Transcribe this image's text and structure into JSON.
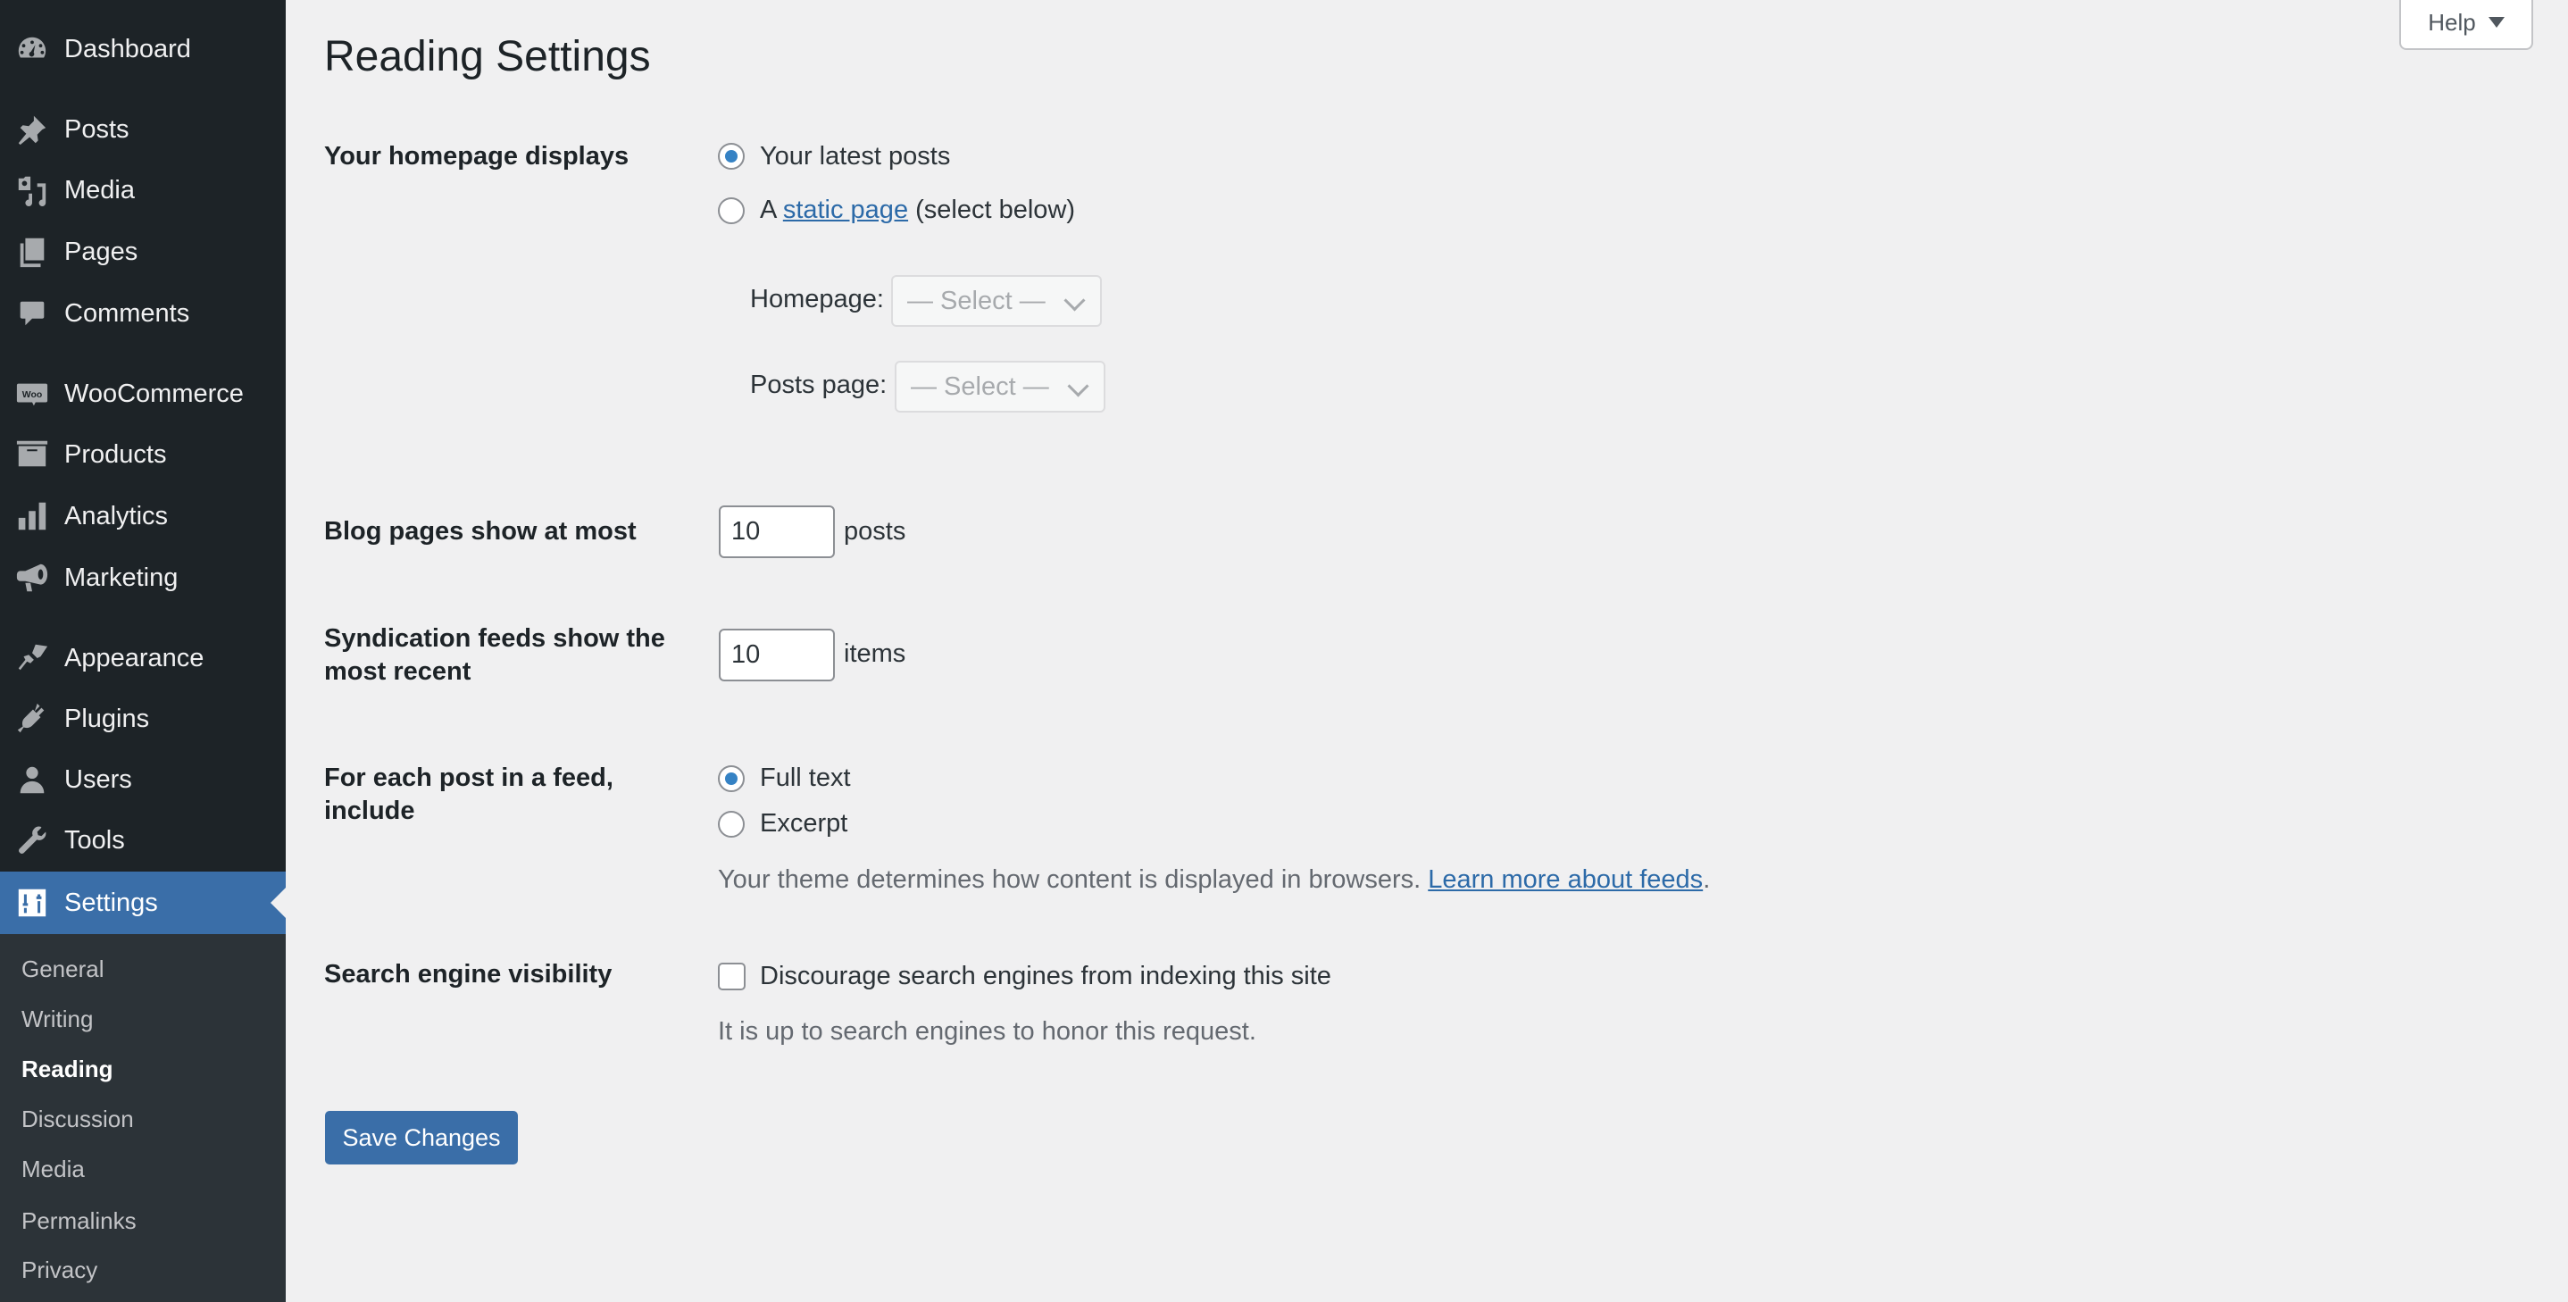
{
  "sidebar": {
    "items": [
      {
        "label": "Dashboard",
        "icon": "dashboard-icon"
      },
      {
        "label": "Posts",
        "icon": "pin-icon"
      },
      {
        "label": "Media",
        "icon": "media-icon"
      },
      {
        "label": "Pages",
        "icon": "pages-icon"
      },
      {
        "label": "Comments",
        "icon": "comment-icon"
      },
      {
        "label": "WooCommerce",
        "icon": "woo-icon"
      },
      {
        "label": "Products",
        "icon": "archive-icon"
      },
      {
        "label": "Analytics",
        "icon": "bar-chart-icon"
      },
      {
        "label": "Marketing",
        "icon": "megaphone-icon"
      },
      {
        "label": "Appearance",
        "icon": "paintbrush-icon"
      },
      {
        "label": "Plugins",
        "icon": "plug-icon"
      },
      {
        "label": "Users",
        "icon": "user-icon"
      },
      {
        "label": "Tools",
        "icon": "wrench-icon"
      },
      {
        "label": "Settings",
        "icon": "settings-sliders-icon",
        "active": true
      }
    ],
    "submenu": [
      {
        "label": "General"
      },
      {
        "label": "Writing"
      },
      {
        "label": "Reading",
        "current": true
      },
      {
        "label": "Discussion"
      },
      {
        "label": "Media"
      },
      {
        "label": "Permalinks"
      },
      {
        "label": "Privacy"
      }
    ]
  },
  "header": {
    "title": "Reading Settings",
    "help_label": "Help"
  },
  "settings": {
    "homepage": {
      "label": "Your homepage displays",
      "option_latest": "Your latest posts",
      "option_static_prefix": "A",
      "option_static_link": "static page",
      "option_static_suffix": "(select below)",
      "selected": "latest",
      "homepage_select_label": "Homepage:",
      "homepage_select_value": "— Select —",
      "posts_page_select_label": "Posts page:",
      "posts_page_select_value": "— Select —"
    },
    "blog_pages": {
      "label": "Blog pages show at most",
      "value": "10",
      "unit": "posts"
    },
    "syndication": {
      "label": "Syndication feeds show the most recent",
      "value": "10",
      "unit": "items"
    },
    "feed_content": {
      "label": "For each post in a feed, include",
      "option_full": "Full text",
      "option_excerpt": "Excerpt",
      "selected": "full",
      "description": "Your theme determines how content is displayed in browsers.",
      "link": "Learn more about feeds",
      "link_suffix": "."
    },
    "search_visibility": {
      "label": "Search engine visibility",
      "checkbox_label": "Discourage search engines from indexing this site",
      "checked": false,
      "note": "It is up to search engines to honor this request."
    }
  },
  "actions": {
    "save_label": "Save Changes"
  },
  "colors": {
    "sidebar_bg": "#1d2327",
    "submenu_bg": "#2c3338",
    "accent": "#3a6ea8",
    "link": "#2c6aa8",
    "page_bg": "#f0f0f1"
  }
}
